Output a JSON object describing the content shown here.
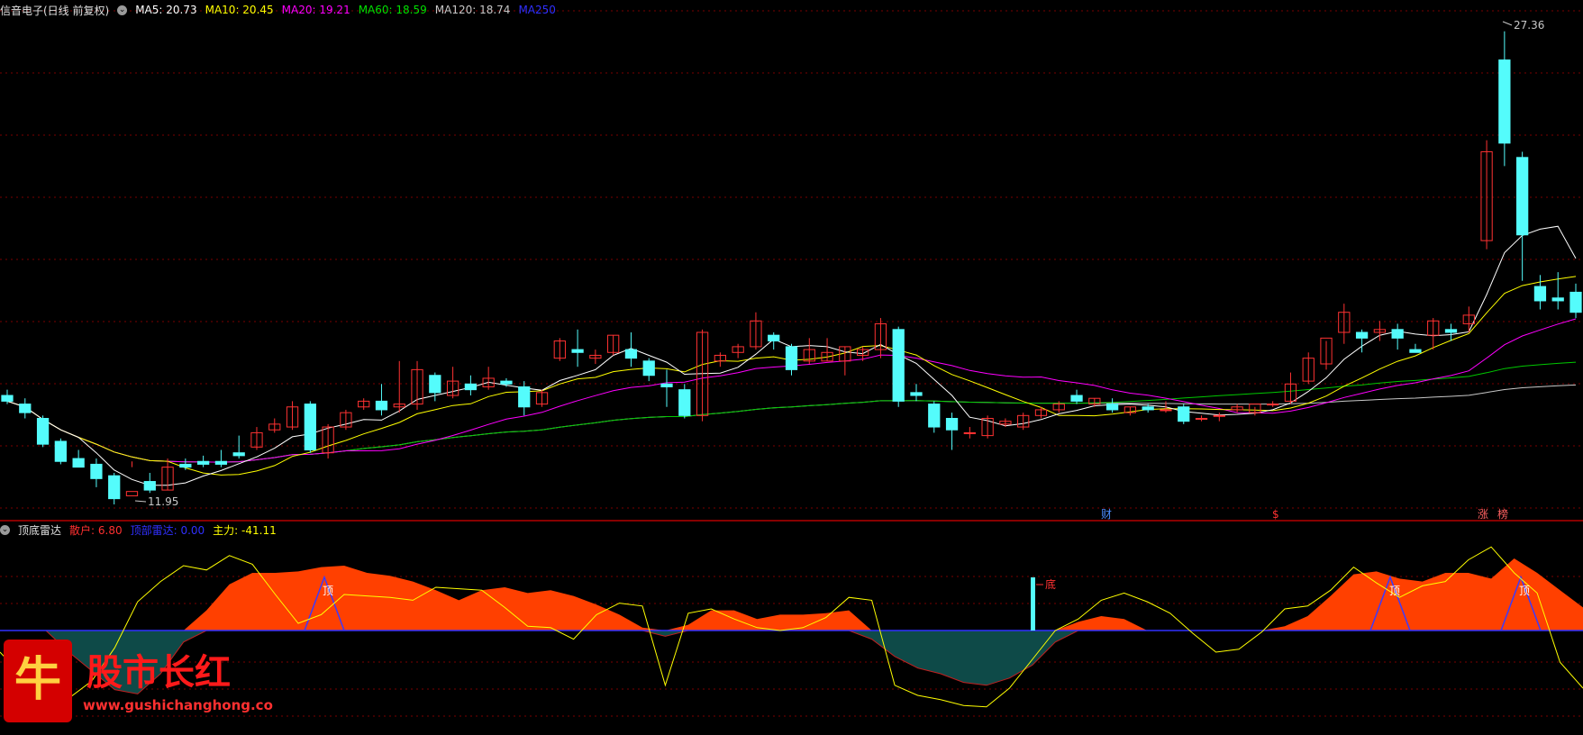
{
  "main_header": {
    "title": "信音电子(日线 前复权)",
    "ma": [
      {
        "label": "MA5: 20.73",
        "color": "#ffffff"
      },
      {
        "label": "MA10: 20.45",
        "color": "#ffff00"
      },
      {
        "label": "MA20: 19.21",
        "color": "#ff00ff"
      },
      {
        "label": "MA60: 18.59",
        "color": "#00e000"
      },
      {
        "label": "MA120: 18.74",
        "color": "#c8c8c8"
      },
      {
        "label": "MA250",
        "color": "#3030ff"
      }
    ]
  },
  "indicator_header": {
    "title": "顶底雷达",
    "items": [
      {
        "label": "散户: 6.80",
        "color": "#ff3030"
      },
      {
        "label": "顶部雷达: 0.00",
        "color": "#3030ff"
      },
      {
        "label": "主力: -41.11",
        "color": "#ffff00"
      }
    ]
  },
  "annotations": {
    "high": "27.36",
    "low": "11.95",
    "markers": [
      "财",
      "$",
      "涨",
      "榜"
    ],
    "top_label": "顶",
    "bottom_label": "底"
  },
  "watermark": {
    "icon_char": "牛",
    "brand": "股市长红",
    "url": "www.gushichanghong.com"
  },
  "colors": {
    "up": "#ff3232",
    "down": "#54fcfc",
    "grid": "#7a0000",
    "bg": "#000000"
  },
  "chart_data": [
    {
      "type": "candlestick",
      "title": "信音电子(日线 前复权)",
      "ylim": [
        11.5,
        28.4
      ],
      "candles": [
        [
          15.3,
          15.5,
          15.1,
          15.0
        ],
        [
          15.0,
          15.2,
          14.7,
          14.5
        ],
        [
          14.5,
          14.6,
          13.6,
          13.5
        ],
        [
          13.7,
          13.8,
          13.0,
          12.9
        ],
        [
          13.1,
          13.4,
          12.8,
          12.9
        ],
        [
          12.9,
          13.1,
          12.4,
          12.1
        ],
        [
          12.5,
          12.6,
          11.7,
          11.5
        ],
        [
          11.8,
          13.0,
          11.95,
          12.8
        ],
        [
          12.3,
          12.6,
          12.0,
          11.9
        ],
        [
          12.0,
          13.1,
          12.8,
          12.0
        ],
        [
          12.9,
          13.1,
          12.8,
          12.7
        ],
        [
          13.0,
          13.2,
          12.9,
          12.8
        ],
        [
          13.0,
          13.4,
          12.9,
          12.8
        ],
        [
          13.3,
          13.9,
          13.2,
          13.1
        ],
        [
          13.5,
          14.2,
          14.0,
          13.4
        ],
        [
          14.1,
          14.5,
          14.3,
          14.0
        ],
        [
          14.2,
          15.1,
          14.9,
          14.1
        ],
        [
          15.0,
          15.1,
          13.4,
          13.3
        ],
        [
          13.3,
          14.3,
          14.2,
          13.1
        ],
        [
          14.2,
          14.8,
          14.7,
          14.1
        ],
        [
          14.9,
          15.2,
          15.1,
          14.8
        ],
        [
          15.1,
          15.7,
          14.8,
          14.6
        ],
        [
          14.9,
          16.5,
          15.0,
          14.7
        ],
        [
          15.0,
          16.5,
          16.2,
          14.8
        ],
        [
          16.0,
          16.1,
          15.4,
          15.1
        ],
        [
          15.3,
          16.3,
          15.8,
          15.2
        ],
        [
          15.7,
          16.0,
          15.5,
          15.3
        ],
        [
          15.6,
          16.3,
          15.9,
          15.5
        ],
        [
          15.8,
          15.9,
          15.7,
          15.6
        ],
        [
          15.6,
          15.8,
          14.9,
          14.6
        ],
        [
          15.0,
          15.5,
          15.4,
          14.9
        ],
        [
          16.6,
          17.3,
          17.2,
          16.5
        ],
        [
          16.9,
          17.6,
          16.8,
          16.3
        ],
        [
          16.6,
          16.9,
          16.7,
          16.4
        ],
        [
          16.8,
          17.4,
          17.4,
          16.7
        ],
        [
          16.9,
          17.5,
          16.6,
          16.3
        ],
        [
          16.5,
          16.6,
          16.0,
          15.8
        ],
        [
          15.7,
          16.2,
          15.6,
          14.9
        ],
        [
          15.5,
          15.7,
          14.6,
          14.5
        ],
        [
          14.6,
          17.6,
          17.5,
          14.4
        ],
        [
          16.5,
          16.8,
          16.7,
          16.3
        ],
        [
          16.8,
          17.1,
          17.0,
          16.6
        ],
        [
          17.0,
          18.2,
          17.9,
          16.9
        ],
        [
          17.4,
          17.5,
          17.2,
          16.9
        ],
        [
          17.0,
          17.1,
          16.2,
          16.0
        ],
        [
          16.5,
          17.3,
          16.9,
          16.4
        ],
        [
          16.5,
          17.3,
          16.8,
          16.5
        ],
        [
          16.5,
          17.0,
          17.0,
          16.0
        ],
        [
          16.7,
          17.0,
          16.9,
          16.5
        ],
        [
          16.9,
          18.0,
          17.8,
          16.6
        ],
        [
          17.6,
          17.7,
          15.1,
          14.9
        ],
        [
          15.4,
          15.7,
          15.3,
          15.1
        ],
        [
          15.0,
          15.1,
          14.2,
          14.0
        ],
        [
          14.5,
          14.7,
          14.1,
          13.4
        ],
        [
          14.0,
          14.2,
          14.0,
          13.8
        ],
        [
          13.9,
          14.6,
          14.5,
          13.8
        ],
        [
          14.3,
          14.5,
          14.4,
          14.2
        ],
        [
          14.2,
          14.7,
          14.6,
          14.1
        ],
        [
          14.6,
          14.9,
          14.8,
          14.5
        ],
        [
          14.8,
          15.1,
          15.0,
          14.7
        ],
        [
          15.3,
          15.5,
          15.1,
          15.0
        ],
        [
          15.0,
          15.2,
          15.2,
          14.9
        ],
        [
          15.0,
          15.2,
          14.8,
          14.7
        ],
        [
          14.7,
          14.9,
          14.9,
          14.6
        ],
        [
          14.9,
          15.0,
          14.8,
          14.7
        ],
        [
          14.8,
          15.1,
          14.8,
          14.7
        ],
        [
          14.9,
          15.0,
          14.4,
          14.3
        ],
        [
          14.5,
          14.6,
          14.5,
          14.4
        ],
        [
          14.6,
          14.7,
          14.6,
          14.4
        ],
        [
          14.8,
          15.0,
          14.9,
          14.7
        ],
        [
          14.7,
          14.9,
          15.0,
          14.6
        ],
        [
          15.0,
          15.1,
          15.0,
          14.9
        ],
        [
          15.1,
          16.1,
          15.7,
          15.0
        ],
        [
          15.8,
          16.8,
          16.6,
          15.7
        ],
        [
          16.4,
          17.2,
          17.3,
          16.2
        ],
        [
          17.5,
          18.5,
          18.2,
          17.1
        ],
        [
          17.5,
          17.6,
          17.3,
          16.8
        ],
        [
          17.5,
          17.9,
          17.6,
          17.2
        ],
        [
          17.6,
          17.8,
          17.3,
          16.9
        ],
        [
          16.9,
          17.1,
          16.8,
          16.8
        ],
        [
          17.4,
          18.0,
          17.9,
          16.9
        ],
        [
          17.6,
          17.8,
          17.5,
          17.2
        ],
        [
          17.8,
          18.4,
          18.1,
          17.5
        ],
        [
          20.7,
          24.2,
          23.8,
          20.4
        ],
        [
          27.0,
          28.0,
          24.1,
          23.3
        ],
        [
          23.6,
          23.8,
          20.9,
          19.3
        ],
        [
          19.1,
          19.5,
          18.6,
          18.3
        ],
        [
          18.7,
          19.6,
          18.6,
          18.3
        ],
        [
          18.9,
          19.2,
          18.2,
          18.0
        ]
      ]
    },
    {
      "type": "area",
      "title": "顶底雷达",
      "ylim": [
        -60,
        60
      ],
      "series": [
        {
          "name": "散户",
          "values": [
            0,
            0,
            0,
            -15,
            -28,
            -41,
            -44,
            -30,
            -8,
            14,
            32,
            40,
            40,
            41,
            44,
            45,
            40,
            38,
            34,
            28,
            21,
            28,
            30,
            26,
            28,
            24,
            18,
            11,
            2,
            -4,
            4,
            14,
            14,
            8,
            11,
            11,
            12,
            14,
            -6,
            -18,
            -26,
            -30,
            -36,
            -38,
            -33,
            -24,
            -8,
            6,
            10,
            8,
            0,
            0,
            0,
            0,
            0,
            0,
            3,
            10,
            24,
            39,
            41,
            36,
            34,
            40,
            40,
            36,
            50,
            40,
            28,
            16
          ]
        },
        {
          "name": "主力",
          "values": [
            -15,
            -32,
            -52,
            -47,
            -35,
            -12,
            20,
            34,
            45,
            42,
            52,
            46,
            25,
            5,
            11,
            25,
            24,
            23,
            21,
            30,
            29,
            28,
            16,
            3,
            2,
            -6,
            11,
            19,
            17,
            -38,
            12,
            15,
            8,
            2,
            0,
            2,
            9,
            23,
            21,
            -38,
            -45,
            -48,
            -52,
            -53,
            -40,
            -20,
            0,
            8,
            21,
            26,
            20,
            12,
            -2,
            -15,
            -13,
            -1,
            15,
            17,
            28,
            44,
            33,
            23,
            31,
            34,
            49,
            58,
            40,
            26,
            -22,
            -40
          ]
        },
        {
          "name": "顶部雷达",
          "values": [
            0,
            0,
            0,
            0,
            0,
            0,
            0,
            0,
            0,
            0,
            0,
            0,
            0,
            0,
            0,
            0,
            0,
            0,
            0,
            0,
            0,
            0,
            0,
            0,
            0,
            0,
            0,
            0,
            0,
            0,
            0,
            0,
            0,
            0,
            0,
            0,
            0,
            0,
            0,
            0,
            0,
            0,
            0,
            0,
            0,
            0,
            0,
            0,
            0,
            0,
            0,
            0,
            0,
            0,
            0,
            0,
            0,
            0,
            0,
            0,
            0,
            0,
            0,
            0,
            0,
            0,
            0,
            0,
            0,
            0
          ]
        }
      ]
    }
  ]
}
